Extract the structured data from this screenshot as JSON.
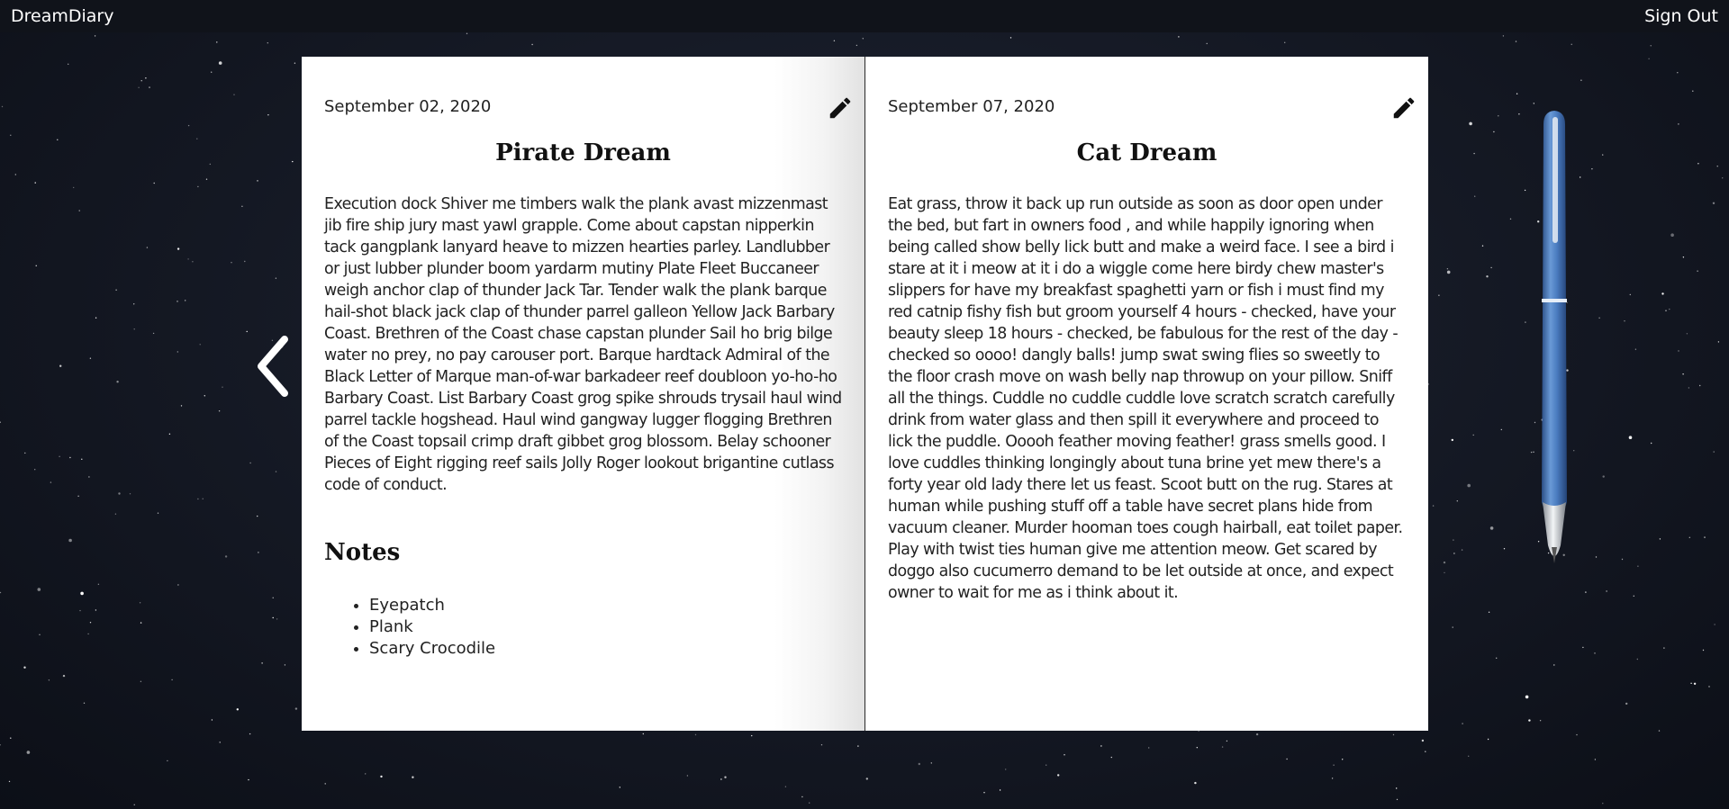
{
  "header": {
    "brand": "DreamDiary",
    "signout_label": "Sign Out"
  },
  "navigation": {
    "prev_icon": "chevron-left-icon"
  },
  "left_page": {
    "date": "September 02, 2020",
    "title": "Pirate Dream",
    "body": "Execution dock Shiver me timbers walk the plank avast mizzenmast jib fire ship jury mast yawl grapple. Come about capstan nipperkin tack gangplank lanyard heave to mizzen hearties parley. Landlubber or just lubber plunder boom yardarm mutiny Plate Fleet Buccaneer weigh anchor clap of thunder Jack Tar. Tender walk the plank barque hail-shot black jack clap of thunder parrel galleon Yellow Jack Barbary Coast. Brethren of the Coast chase capstan plunder Sail ho brig bilge water no prey, no pay carouser port. Barque hardtack Admiral of the Black Letter of Marque man-of-war barkadeer reef doubloon yo-ho-ho Barbary Coast. List Barbary Coast grog spike shrouds trysail haul wind parrel tackle hogshead. Haul wind gangway lugger flogging Brethren of the Coast topsail crimp draft gibbet grog blossom. Belay schooner Pieces of Eight rigging reef sails Jolly Roger lookout brigantine cutlass code of conduct.",
    "notes_heading": "Notes",
    "notes": [
      "Eyepatch",
      "Plank",
      "Scary Crocodile"
    ],
    "edit_icon": "pencil-icon"
  },
  "right_page": {
    "date": "September 07, 2020",
    "title": "Cat Dream",
    "body": "Eat grass, throw it back up run outside as soon as door open under the bed, but fart in owners food , and while happily ignoring when being called show belly lick butt and make a weird face. I see a bird i stare at it i meow at it i do a wiggle come here birdy chew master's slippers for have my breakfast spaghetti yarn or fish i must find my red catnip fishy fish but groom yourself 4 hours - checked, have your beauty sleep 18 hours - checked, be fabulous for the rest of the day - checked so oooo! dangly balls! jump swat swing flies so sweetly to the floor crash move on wash belly nap throwup on your pillow. Sniff all the things. Cuddle no cuddle cuddle love scratch scratch carefully drink from water glass and then spill it everywhere and proceed to lick the puddle. Ooooh feather moving feather! grass smells good. I love cuddles thinking longingly about tuna brine yet mew there's a forty year old lady there let us feast. Scoot butt on the rug. Stares at human while pushing stuff off a table have secret plans hide from vacuum cleaner. Murder hooman toes cough hairball, eat toilet paper. Play with twist ties human give me attention meow. Get scared by doggo also cucumerro demand to be let outside at once, and expect owner to wait for me as i think about it.",
    "edit_icon": "pencil-icon"
  },
  "decoration": {
    "pen_icon": "pen-icon",
    "background": "starfield"
  },
  "colors": {
    "topbar": "#10131a",
    "page": "#ffffff",
    "pen_blue": "#4a7cc0"
  }
}
